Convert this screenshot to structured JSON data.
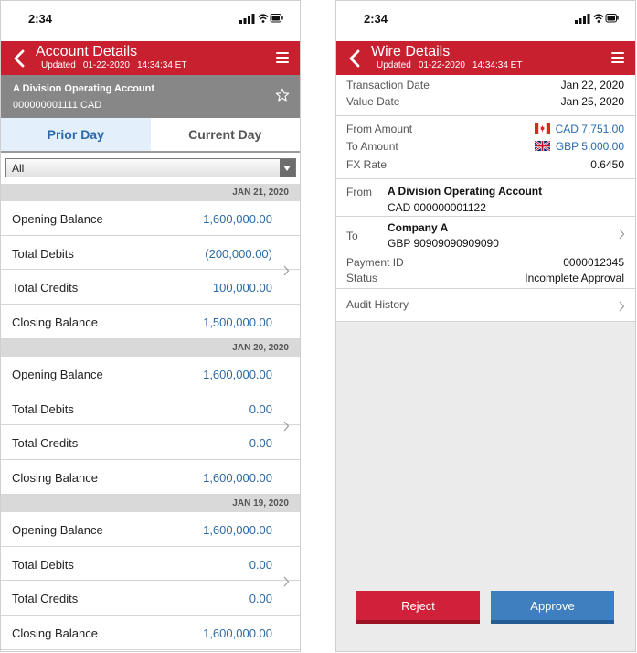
{
  "left": {
    "status_time": "2:34",
    "header": {
      "title": "Account Details",
      "updated_label": "Updated",
      "updated_date": "01-22-2020",
      "updated_time": "14:34:34 ET"
    },
    "account": {
      "name": "A Division Operating Account",
      "number": "000000001111 CAD"
    },
    "tabs": [
      {
        "label": "Prior Day",
        "active": true
      },
      {
        "label": "Current Day",
        "active": false
      }
    ],
    "filter": {
      "selected": "All"
    },
    "groups": [
      {
        "date": "JAN 21, 2020",
        "rows": [
          {
            "label": "Opening Balance",
            "value": "1,600,000.00"
          },
          {
            "label": "Total Debits",
            "value": "(200,000.00)"
          },
          {
            "label": "Total Credits",
            "value": "100,000.00"
          },
          {
            "label": "Closing Balance",
            "value": "1,500,000.00"
          }
        ]
      },
      {
        "date": "JAN 20, 2020",
        "rows": [
          {
            "label": "Opening Balance",
            "value": "1,600,000.00"
          },
          {
            "label": "Total Debits",
            "value": "0.00"
          },
          {
            "label": "Total Credits",
            "value": "0.00"
          },
          {
            "label": "Closing Balance",
            "value": "1,600,000.00"
          }
        ]
      },
      {
        "date": "JAN 19, 2020",
        "rows": [
          {
            "label": "Opening Balance",
            "value": "1,600,000.00"
          },
          {
            "label": "Total Debits",
            "value": "0.00"
          },
          {
            "label": "Total Credits",
            "value": "0.00"
          },
          {
            "label": "Closing Balance",
            "value": "1,600,000.00"
          }
        ]
      }
    ]
  },
  "right": {
    "status_time": "2:34",
    "header": {
      "title": "Wire Details",
      "updated_label": "Updated",
      "updated_date": "01-22-2020",
      "updated_time": "14:34:34 ET"
    },
    "dates": {
      "transaction_label": "Transaction Date",
      "transaction_value": "Jan 22, 2020",
      "value_label": "Value Date",
      "value_value": "Jan 25, 2020"
    },
    "amounts": {
      "from_label": "From Amount",
      "from_value": "CAD 7,751.00",
      "to_label": "To Amount",
      "to_value": "GBP 5,000.00",
      "fx_label": "FX Rate",
      "fx_value": "0.6450"
    },
    "from": {
      "label": "From",
      "name": "A Division Operating Account",
      "account": "CAD 000000001122"
    },
    "to": {
      "label": "To",
      "name": "Company A",
      "account": "GBP 90909090909090"
    },
    "payment": {
      "id_label": "Payment ID",
      "id_value": "0000012345",
      "status_label": "Status",
      "status_value": "Incomplete Approval"
    },
    "audit": {
      "label": "Audit History"
    },
    "buttons": {
      "reject": "Reject",
      "approve": "Approve"
    }
  },
  "colors": {
    "header_red": "#c8202f",
    "link_blue": "#2b6aa8",
    "account_gray": "#878787",
    "tab_active_bg": "#e3effb",
    "reject": "#d0213a",
    "approve": "#3f7fbf"
  }
}
